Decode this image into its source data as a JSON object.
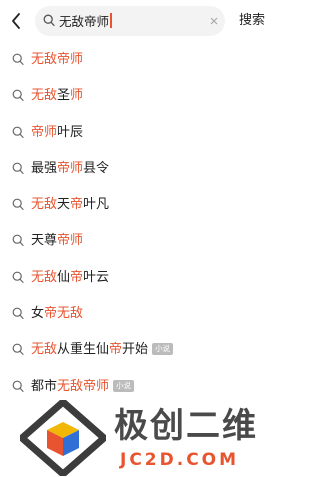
{
  "search": {
    "query": "无敌帝师",
    "button_label": "搜索"
  },
  "suggestions": [
    {
      "parts": [
        {
          "text": "无敌帝师",
          "hl": true
        }
      ],
      "tag": null
    },
    {
      "parts": [
        {
          "text": "无敌",
          "hl": true
        },
        {
          "text": "圣",
          "hl": false
        },
        {
          "text": "师",
          "hl": true
        }
      ],
      "tag": null
    },
    {
      "parts": [
        {
          "text": "帝师",
          "hl": true
        },
        {
          "text": "叶辰",
          "hl": false
        }
      ],
      "tag": null
    },
    {
      "parts": [
        {
          "text": "最强",
          "hl": false
        },
        {
          "text": "帝师",
          "hl": true
        },
        {
          "text": "县令",
          "hl": false
        }
      ],
      "tag": null
    },
    {
      "parts": [
        {
          "text": "无敌",
          "hl": true
        },
        {
          "text": "天",
          "hl": false
        },
        {
          "text": "帝",
          "hl": true
        },
        {
          "text": "叶凡",
          "hl": false
        }
      ],
      "tag": null
    },
    {
      "parts": [
        {
          "text": "天尊",
          "hl": false
        },
        {
          "text": "帝师",
          "hl": true
        }
      ],
      "tag": null
    },
    {
      "parts": [
        {
          "text": "无敌",
          "hl": true
        },
        {
          "text": "仙",
          "hl": false
        },
        {
          "text": "帝",
          "hl": true
        },
        {
          "text": "叶云",
          "hl": false
        }
      ],
      "tag": null
    },
    {
      "parts": [
        {
          "text": "女",
          "hl": false
        },
        {
          "text": "帝无敌",
          "hl": true
        }
      ],
      "tag": null
    },
    {
      "parts": [
        {
          "text": "无敌",
          "hl": true
        },
        {
          "text": "从重生仙",
          "hl": false
        },
        {
          "text": "帝",
          "hl": true
        },
        {
          "text": "开始",
          "hl": false
        }
      ],
      "tag": "小说"
    },
    {
      "parts": [
        {
          "text": "都市",
          "hl": false
        },
        {
          "text": "无敌帝师",
          "hl": true
        }
      ],
      "tag": "小说"
    }
  ],
  "watermark": {
    "title": "极创二维",
    "subtitle": "JC2D.COM"
  },
  "colors": {
    "highlight": "#e8542f",
    "text": "#222222",
    "search_bg": "#f3f3f3",
    "tag_bg": "#bbbbbb"
  },
  "icons": [
    "back-arrow-icon",
    "search-icon",
    "clear-icon",
    "logo-cube-icon"
  ]
}
